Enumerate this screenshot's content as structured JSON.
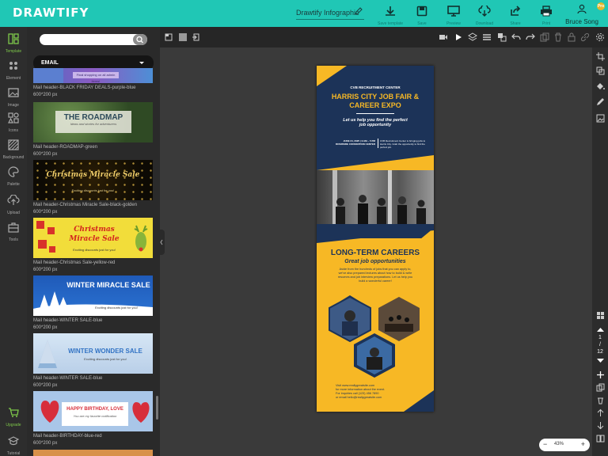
{
  "app": {
    "logo": "DRAWTIFY",
    "doc_title": "Drawtify Infographic",
    "user_name": "Bruce Song",
    "pro_badge": "Pro"
  },
  "toolbar": [
    {
      "name": "save-as-template-button",
      "label": "Save template",
      "icon": "download-icon"
    },
    {
      "name": "save-button",
      "label": "Save",
      "icon": "save-icon"
    },
    {
      "name": "preview-button",
      "label": "Preview",
      "icon": "monitor-icon"
    },
    {
      "name": "download-button",
      "label": "Download",
      "icon": "cloud-download-icon"
    },
    {
      "name": "share-button",
      "label": "Share",
      "icon": "share-icon"
    },
    {
      "name": "print-button",
      "label": "Print",
      "icon": "printer-icon"
    }
  ],
  "left_rail": [
    {
      "name": "template",
      "label": "Template",
      "active": true
    },
    {
      "name": "element",
      "label": "Element",
      "active": false
    },
    {
      "name": "image",
      "label": "Image",
      "active": false
    },
    {
      "name": "icons",
      "label": "Icons",
      "active": false
    },
    {
      "name": "background",
      "label": "Background",
      "active": false
    },
    {
      "name": "palette",
      "label": "Palette",
      "active": false
    },
    {
      "name": "upload",
      "label": "Upload",
      "active": false
    },
    {
      "name": "tools",
      "label": "Tools",
      "active": false
    },
    {
      "name": "upgrade",
      "label": "Upgrade",
      "active": true
    },
    {
      "name": "tutorial",
      "label": "Tutorial",
      "active": false
    }
  ],
  "panel": {
    "search_placeholder": "",
    "category": "EMAIL",
    "templates": [
      {
        "name": "Mail header-BLACK FRIDAY DEALS-purple-blue",
        "size": "600*200 px",
        "thumb_text": "Final shopping on all admin items!",
        "thumb_sub": ""
      },
      {
        "name": "Mail header-ROADMAP-green",
        "size": "600*200 px",
        "thumb_text": "THE ROADMAP",
        "thumb_sub": "Ideas and stories for adventurers"
      },
      {
        "name": "Mail header-Christmas Miracle Sale-black-golden",
        "size": "600*200 px",
        "thumb_text": "Christmas Miracle Sale",
        "thumb_sub": "Exciting discounts just for you!"
      },
      {
        "name": "Mail header-Christmas Sale-yellow-red",
        "size": "600*200 px",
        "thumb_text": "Christmas Miracle Sale",
        "thumb_sub": "Exciting discounts just for you!"
      },
      {
        "name": "Mail header-WINTER SALE-blue",
        "size": "600*200 px",
        "thumb_text": "WINTER MIRACLE SALE",
        "thumb_sub": "Exciting discounts just for you!"
      },
      {
        "name": "Mail header-WINTER SALE-blue",
        "size": "600*200 px",
        "thumb_text": "WINTER WONDER SALE",
        "thumb_sub": "Exciting discounts just for you!"
      },
      {
        "name": "Mail header-BIRTHDAY-blue-red",
        "size": "600*200 px",
        "thumb_text": "HAPPY BIRTHDAY, LOVE",
        "thumb_sub": "You are my favorite notification"
      }
    ]
  },
  "poster": {
    "org": "CVB RECRUITMENT CENTER",
    "title": "HARRIS CITY JOB FAIR & CAREER EXPO",
    "tagline": "Let us help you find the perfect job opportunity",
    "date": "JUNE 24, 2025 | 9 AM – 5 PM",
    "venue": "RIVERSIDE CONVENTION CENTER",
    "side_text": "CVB Recruitment Center is bringing jobs to Harris City. Grab the opportunity to find the perfect job.",
    "section_title": "LONG-TERM CAREERS",
    "section_sub": "Great job opportunities",
    "body": "Aside from the hundreds of jobs that you can apply to, we've also prepared lectures about how to build & write resumes and job interview preparations. Let us help you build a wonderful career!",
    "contact1": "Visit www.reallygreatsite.com",
    "contact2": "for more information about the event.",
    "contact3": "For inquiries call (123) 456 7890",
    "contact4": "or email hello@reallygreatsite.com"
  },
  "pages": {
    "current": "1",
    "sep": "/",
    "total": "12"
  },
  "zoom": {
    "value": "43%",
    "minus": "−",
    "plus": "+"
  },
  "colors": {
    "brand": "#20c7b5",
    "poster_yellow": "#f7b825",
    "poster_navy": "#1c3358",
    "active_green": "#7ec84a"
  }
}
